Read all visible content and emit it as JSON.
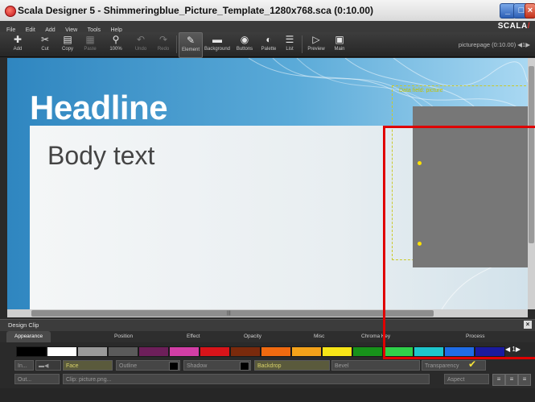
{
  "window": {
    "title": "Scala Designer 5 - Shimmeringblue_Picture_Template_1280x768.sca (0:10.00)",
    "min_label": "_",
    "max_label": "□",
    "close_label": "×"
  },
  "menu": {
    "items": [
      "File",
      "Edit",
      "Add",
      "View",
      "Tools",
      "Help"
    ],
    "brand": "SCALA",
    "brand_mark": "/"
  },
  "toolbar": {
    "items": [
      {
        "label": "Add",
        "icon": "plus-icon",
        "glyph": "✚"
      },
      {
        "label": "Cut",
        "icon": "scissors-icon",
        "glyph": "✂"
      },
      {
        "label": "Copy",
        "icon": "copy-icon",
        "glyph": "▤"
      },
      {
        "label": "Paste",
        "icon": "paste-icon",
        "glyph": "▦"
      },
      {
        "label": "100%",
        "icon": "zoom-icon",
        "glyph": "⚲"
      },
      {
        "label": "Undo",
        "icon": "undo-icon",
        "glyph": "↶"
      },
      {
        "label": "Redo",
        "icon": "redo-icon",
        "glyph": "↷"
      },
      {
        "label": "Element",
        "icon": "pen-icon",
        "glyph": "✎"
      },
      {
        "label": "Background",
        "icon": "background-icon",
        "glyph": "▬"
      },
      {
        "label": "Buttons",
        "icon": "buttons-icon",
        "glyph": "◉"
      },
      {
        "label": "Palette",
        "icon": "palette-icon",
        "glyph": "◐"
      },
      {
        "label": "List",
        "icon": "list-icon",
        "glyph": "☰"
      },
      {
        "label": "Preview",
        "icon": "play-icon",
        "glyph": "▷"
      },
      {
        "label": "Main",
        "icon": "main-icon",
        "glyph": "▣"
      }
    ],
    "page_info": "picturepage (0:10.00) ◀1▶"
  },
  "canvas": {
    "headline": "Headline",
    "body": "Body text",
    "datafield_label": "Data field: picture"
  },
  "panel": {
    "title": "Design Clip",
    "close": "×",
    "tabs": [
      "Appearance",
      "Position",
      "Effect",
      "Opacity",
      "Misc",
      "Chroma Key",
      "Process"
    ],
    "active_tab": "Appearance"
  },
  "swatches": [
    "#000000",
    "#ffffff",
    "#9a9a9a",
    "#5a5a5a",
    "#6d1f5a",
    "#d23ea6",
    "#d8141a",
    "#7a2a0c",
    "#f06a10",
    "#f4a21a",
    "#f7e517",
    "#17921a",
    "#2fd04a",
    "#1ec6cc",
    "#1f6ce6",
    "#1a1a9e"
  ],
  "swatch_nav": "◀ 1▶",
  "fields": {
    "in_label": "In...",
    "face": "Face",
    "outline": "Outline",
    "shadow": "Shadow",
    "backdrop": "Backdrop",
    "bevel": "Bevel",
    "transparency": "Transparency",
    "out_label": "Out...",
    "clip": "Clip: picture.png...",
    "aspect": "Aspect"
  }
}
